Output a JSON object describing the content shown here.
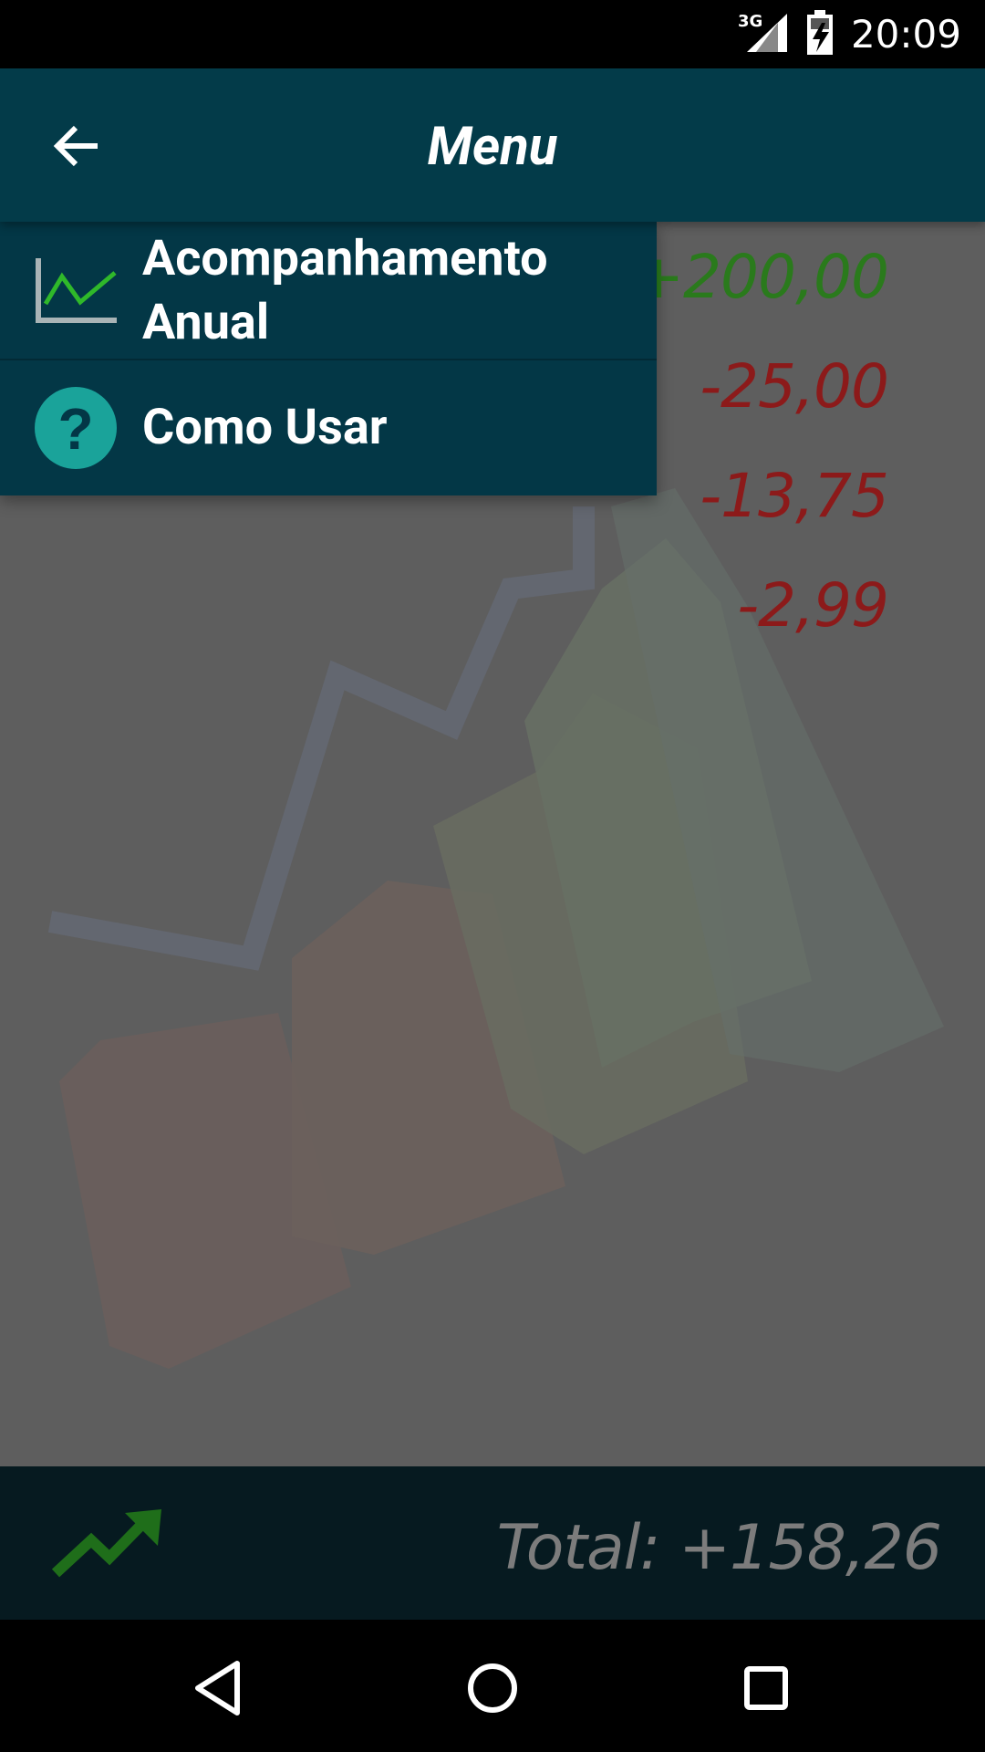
{
  "status_bar": {
    "network": "3G",
    "time": "20:09"
  },
  "header": {
    "title": "Menu"
  },
  "menu": {
    "items": [
      {
        "label_line1": "Acompanhamento",
        "label_line2": "Anual",
        "icon": "line-chart-icon"
      },
      {
        "label": "Como Usar",
        "icon": "help-icon"
      }
    ]
  },
  "transactions": [
    {
      "amount": "+200,00",
      "color": "#2a7a1c"
    },
    {
      "amount": "-25,00",
      "color": "#8c1a1a"
    },
    {
      "amount": "-13,75",
      "color": "#8c1a1a"
    },
    {
      "amount": "-2,99",
      "color": "#8c1a1a"
    }
  ],
  "footer": {
    "total": "Total:  +158,26",
    "icon": "trending-up-icon"
  },
  "colors": {
    "header_bg": "#033b49",
    "accent_teal": "#1aa39a",
    "positive": "#2a7a1c",
    "negative": "#8c1a1a"
  }
}
